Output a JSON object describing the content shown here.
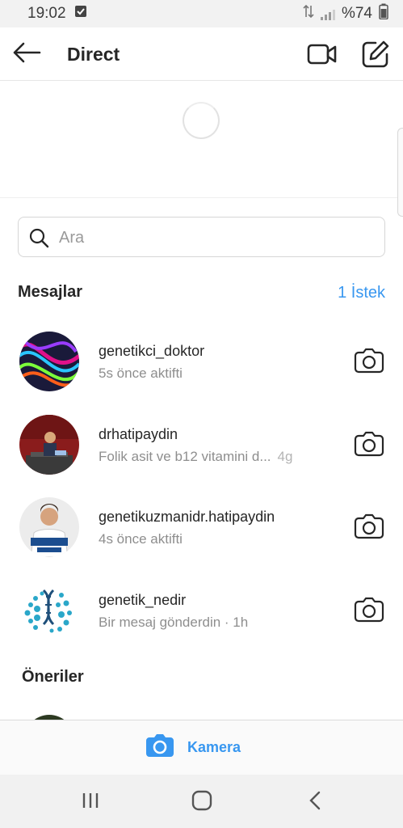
{
  "status_bar": {
    "time": "19:02",
    "battery": "%74",
    "icons": [
      "check-notification-icon",
      "data-transfer-icon",
      "signal-icon",
      "battery-icon"
    ]
  },
  "header": {
    "title": "Direct",
    "icons": [
      "back-arrow-icon",
      "video-call-icon",
      "compose-icon"
    ]
  },
  "search": {
    "placeholder": "Ara"
  },
  "messages_section": {
    "title": "Mesajlar",
    "requests_label": "1 İstek"
  },
  "threads": [
    {
      "username": "genetikci_doktor",
      "subtitle": "5s önce aktifti",
      "time": ""
    },
    {
      "username": "drhatipaydin",
      "subtitle": "Folik asit ve b12 vitamini d...",
      "time": "4g"
    },
    {
      "username": "genetikuzmanidr.hatipaydin",
      "subtitle": "4s önce aktifti",
      "time": ""
    },
    {
      "username": "genetik_nedir",
      "subtitle": "Bir mesaj gönderdin · 1h",
      "time": ""
    }
  ],
  "suggestions_section": {
    "title": "Öneriler"
  },
  "camera_bar": {
    "label": "Kamera"
  },
  "colors": {
    "accent": "#3897f0",
    "text_primary": "#262626",
    "text_secondary": "#8e8e8e"
  }
}
